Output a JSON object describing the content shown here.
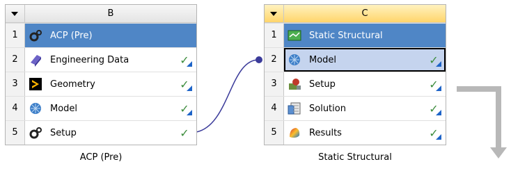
{
  "systemB": {
    "column": "B",
    "caption": "ACP (Pre)",
    "rows": [
      {
        "num": "1",
        "label": "ACP (Pre)",
        "icon": "gears-icon"
      },
      {
        "num": "2",
        "label": "Engineering Data",
        "icon": "book-icon",
        "check": "✓"
      },
      {
        "num": "3",
        "label": "Geometry",
        "icon": "geometry-icon",
        "check": "✓"
      },
      {
        "num": "4",
        "label": "Model",
        "icon": "model-cube-icon",
        "check": "✓"
      },
      {
        "num": "5",
        "label": "Setup",
        "icon": "gears-icon",
        "check": "✓"
      }
    ]
  },
  "systemC": {
    "column": "C",
    "caption": "Static Structural",
    "rows": [
      {
        "num": "1",
        "label": "Static Structural",
        "icon": "static-structural-icon"
      },
      {
        "num": "2",
        "label": "Model",
        "icon": "model-cube-icon",
        "check": "✓"
      },
      {
        "num": "3",
        "label": "Setup",
        "icon": "setup-icon",
        "check": "✓"
      },
      {
        "num": "4",
        "label": "Solution",
        "icon": "solution-icon",
        "check": "✓"
      },
      {
        "num": "5",
        "label": "Results",
        "icon": "results-icon",
        "check": "✓"
      }
    ]
  },
  "colors": {
    "title_bar": "#4f86c6",
    "check": "#3c8c3c",
    "link": "#3b3b9a"
  }
}
